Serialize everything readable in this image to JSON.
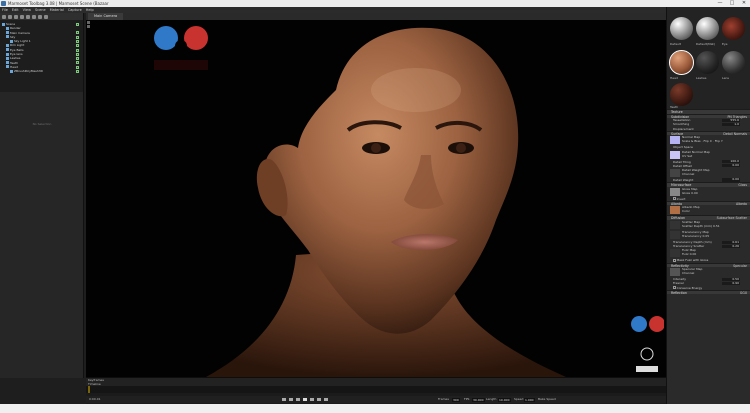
{
  "window": {
    "title": "Marmoset Toolbag 3.08 | Marmoset Scene (Bazaar",
    "controls": [
      "—",
      "□",
      "✕"
    ]
  },
  "menu": [
    "File",
    "Edit",
    "View",
    "Scene",
    "Material",
    "Capture",
    "Help"
  ],
  "scene_tree": {
    "items": [
      {
        "label": "Scene",
        "indent": 0
      },
      {
        "label": "Render",
        "indent": 1
      },
      {
        "label": "Main Camera",
        "indent": 1
      },
      {
        "label": "Sky",
        "indent": 1
      },
      {
        "label": "Sky Light 1",
        "indent": 2
      },
      {
        "label": "Rim Light",
        "indent": 1
      },
      {
        "label": "Eye Balls",
        "indent": 1
      },
      {
        "label": "Eye lens",
        "indent": 1
      },
      {
        "label": "Lashes",
        "indent": 1
      },
      {
        "label": "Teeth",
        "indent": 1
      },
      {
        "label": "Head",
        "indent": 1
      },
      {
        "label": "ZBrushPolyMesh3D",
        "indent": 2
      }
    ],
    "no_selection": "No Selection"
  },
  "viewport": {
    "tab": "Main Camera"
  },
  "materials": {
    "items": [
      {
        "label": "Default"
      },
      {
        "label": "Default(Mat)"
      },
      {
        "label": "Eye"
      },
      {
        "label": "Head"
      },
      {
        "label": "Lashes"
      },
      {
        "label": "Lens"
      },
      {
        "label": "Teeth"
      }
    ]
  },
  "properties": {
    "texture_section": "Texture",
    "subdivision": {
      "title": "Subdivision",
      "mode": "PN Triangles",
      "tessellation_label": "Tessellation",
      "tessellation": "555.6",
      "smoothing_label": "Smoothing",
      "smoothing": "1.0"
    },
    "displacement": "Displacement",
    "surface": {
      "title": "Surface",
      "mode": "Detail Normals",
      "normal_map": "Normal Map",
      "scale_bias": "Scale & Bias",
      "flip_x": "Flip X",
      "flip_y": "Flip Y",
      "object_space": "Object Space",
      "detail_normal_map": "Detail Normal Map",
      "uv_set": "UV Set",
      "detail_tiling": "Detail Tiling",
      "detail_tiling_val": "100.0",
      "detail_offset": "Detail Offset",
      "detail_offset_val": "0.00",
      "detail_weight_map": "Detail Weight Map",
      "channel": "Channel",
      "detail_weight": "Detail Weight",
      "detail_weight_val": "0.00"
    },
    "microsurface": {
      "title": "Microsurface",
      "mode": "Gloss",
      "gloss_map": "Gloss Map",
      "gloss": "Gloss",
      "gloss_val": "0.00",
      "invert": "Invert"
    },
    "albedo": {
      "title": "Albedo",
      "mode": "Albedo",
      "albedo_map": "Albedo Map",
      "color": "Color"
    },
    "diffusion": {
      "title": "Diffusion",
      "mode": "Subsurface Scatter",
      "scatter_map": "Scatter Map",
      "scatter_depth": "Scatter Depth (mm)",
      "scatter_depth_val": "0.51",
      "translucency_map": "Translucency Map",
      "translucency": "Translucency",
      "translucency_val": "0.05",
      "translucency_depth": "Translucency Depth (mm)",
      "translucency_depth_val": "0.61",
      "translucency_scatter": "Translucency Scatter",
      "translucency_scatter_val": "0.26",
      "fuzz_map": "Fuzz Map",
      "fuzz": "Fuzz",
      "fuzz_val": "0.00",
      "mask_fuzz": "Mask Fuzz with Gloss"
    },
    "reflectivity": {
      "title": "Reflectivity",
      "mode": "Specular",
      "specular_map": "Specular Map",
      "channel": "Channel",
      "intensity": "Intensity",
      "intensity_val": "0.50",
      "fresnel": "Fresnel",
      "fresnel_val": "0.90",
      "conserve": "Conserve Energy"
    },
    "reflection": {
      "title": "Reflection",
      "mode": "GGX"
    }
  },
  "timeline": {
    "title": "Keyframes",
    "timeline_label": "Timeline",
    "frame": "0:00.01",
    "frames_label": "Frames",
    "frames": "300",
    "fps_label": "FPS",
    "fps": "30.000",
    "length_label": "Length",
    "length": "10.000",
    "speed_label": "Speed",
    "speed": "1.000",
    "bake_speed": "Bake Speed"
  },
  "colors": {
    "accent": "#c8c8c8",
    "skin": "#a66a45",
    "viewport_bg": "#020202"
  }
}
